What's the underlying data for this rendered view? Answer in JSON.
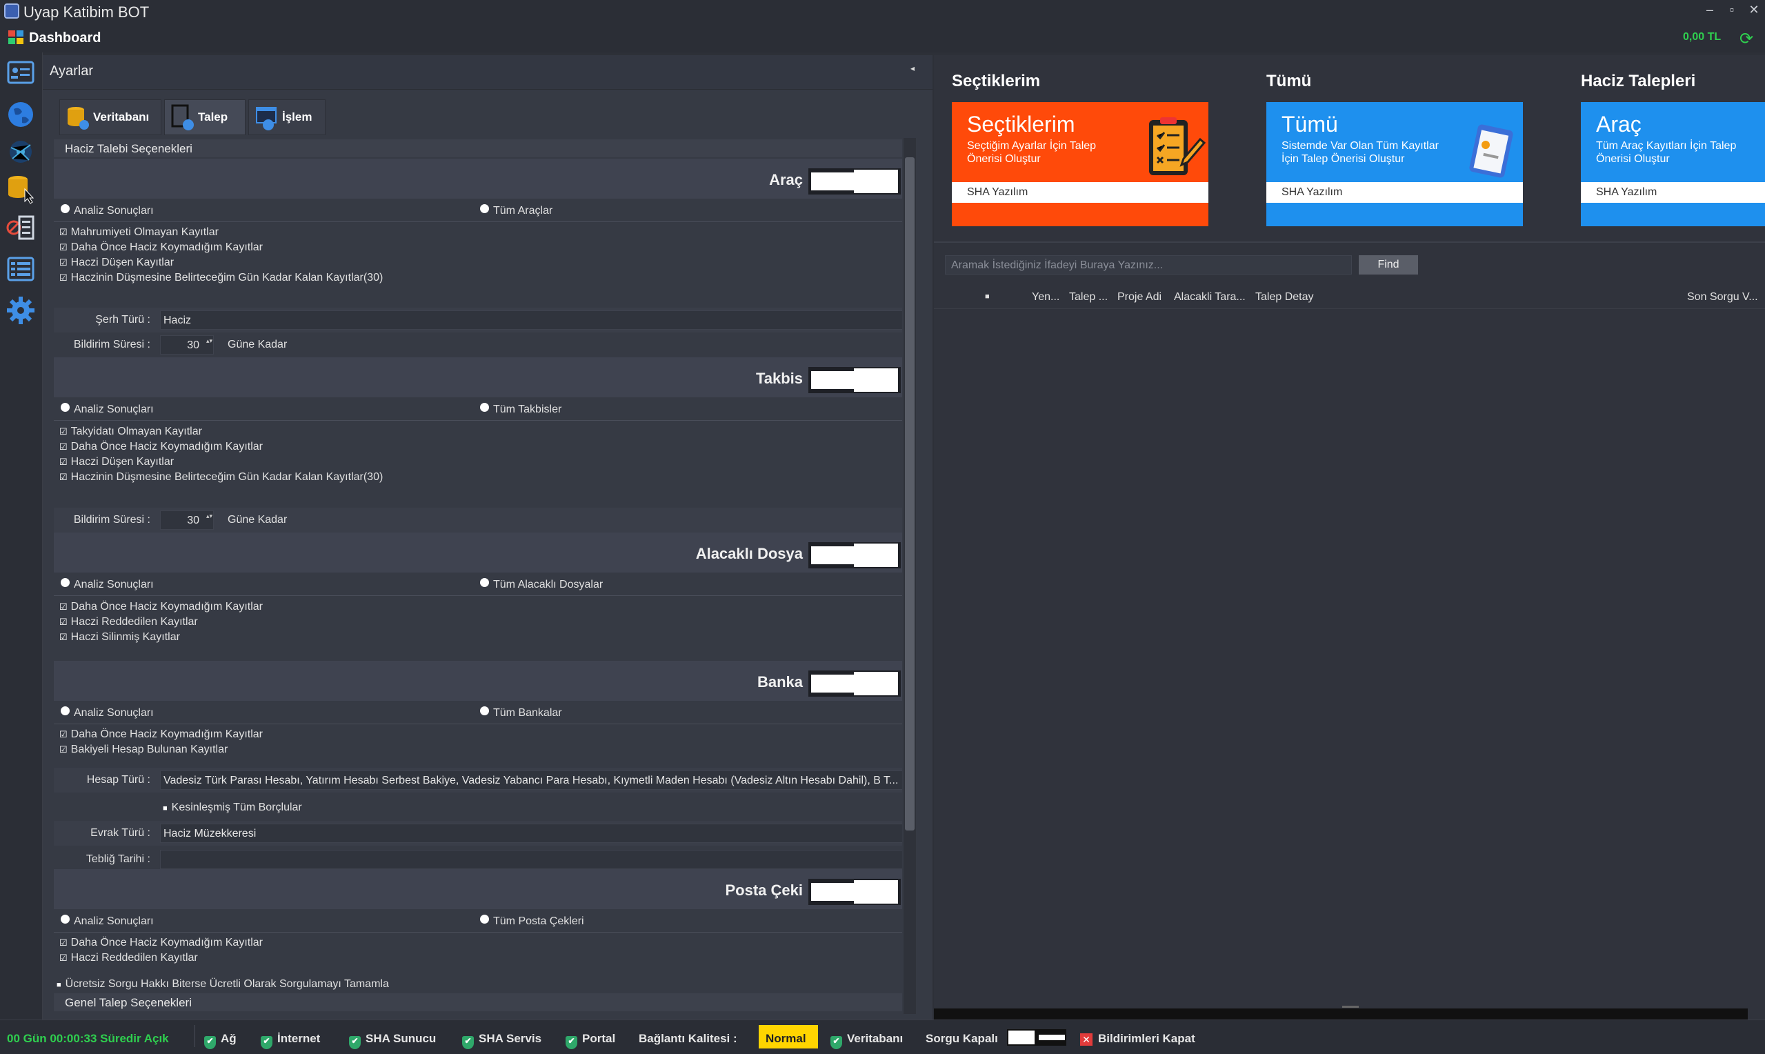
{
  "window": {
    "title": "Uyap Katibim BOT",
    "controls": [
      "–",
      "▫",
      "✕"
    ]
  },
  "header": {
    "title": "Dashboard",
    "balance": "0,00 TL"
  },
  "nav": {
    "icons": [
      "user-list-icon",
      "globe-icon",
      "network-icon",
      "database-icon",
      "checklist-icon",
      "list-icon",
      "gear-icon"
    ]
  },
  "settings": {
    "title": "Ayarlar",
    "tabs": [
      {
        "label": "Veritabanı"
      },
      {
        "label": "Talep"
      },
      {
        "label": "İşlem"
      }
    ],
    "section_title": "Haciz Talebi Seçenekleri",
    "footer_section_title": "Genel Talep Seçenekleri",
    "arac": {
      "title": "Araç",
      "radio_a": "Analiz Sonuçları",
      "radio_b": "Tüm Araçlar",
      "checks": [
        "Mahrumiyeti Olmayan Kayıtlar",
        "Daha Önce Haciz Koymadığım Kayıtlar",
        "Haczi Düşen Kayıtlar",
        "Haczinin Düşmesine Belirteceğim Gün Kadar Kalan Kayıtlar(30)"
      ],
      "serh_label": "Şerh Türü :",
      "serh_value": "Haciz",
      "bildirim_label": "Bildirim Süresi :",
      "bildirim_value": "30",
      "bildirim_unit": "Güne Kadar"
    },
    "takbis": {
      "title": "Takbis",
      "radio_a": "Analiz Sonuçları",
      "radio_b": "Tüm Takbisler",
      "checks": [
        "Takyidatı Olmayan Kayıtlar",
        "Daha Önce Haciz Koymadığım Kayıtlar",
        "Haczi Düşen Kayıtlar",
        "Haczinin Düşmesine Belirteceğim Gün Kadar Kalan Kayıtlar(30)"
      ],
      "bildirim_label": "Bildirim Süresi :",
      "bildirim_value": "30",
      "bildirim_unit": "Güne Kadar"
    },
    "alacakli": {
      "title": "Alacaklı Dosya",
      "radio_a": "Analiz Sonuçları",
      "radio_b": "Tüm Alacaklı Dosyalar",
      "checks": [
        "Daha Önce Haciz Koymadığım Kayıtlar",
        "Haczi Reddedilen Kayıtlar",
        "Haczi Silinmiş Kayıtlar"
      ]
    },
    "banka": {
      "title": "Banka",
      "radio_a": "Analiz Sonuçları",
      "radio_b": "Tüm Bankalar",
      "checks": [
        "Daha Önce Haciz Koymadığım Kayıtlar",
        "Bakiyeli Hesap Bulunan Kayıtlar"
      ],
      "hesap_label": "Hesap Türü :",
      "hesap_value": "Vadesiz Türk Parası Hesabı, Yatırım Hesabı Serbest Bakiye, Vadesiz Yabancı Para Hesabı, Kıymetli Maden Hesabı (Vadesiz Altın Hesabı Dahil), B T...",
      "kesin_label": "Kesinleşmiş Tüm Borçlular",
      "evrak_label": "Evrak Türü :",
      "evrak_value": "Haciz Müzekkeresi",
      "teblig_label": "Tebliğ Tarihi :",
      "teblig_value": ""
    },
    "posta": {
      "title": "Posta Çeki",
      "radio_a": "Analiz Sonuçları",
      "radio_b": "Tüm Posta Çekleri",
      "checks": [
        "Daha Önce Haciz Koymadığım Kayıtlar",
        "Haczi Reddedilen Kayıtlar"
      ]
    },
    "ucretsiz": "Ücretsiz Sorgu Hakkı Biterse Ücretli Olarak Sorgulamayı Tamamla"
  },
  "columns": [
    {
      "title": "Seçtiklerim",
      "tile_title": "Seçtiklerim",
      "tile_sub": "Seçtiğim Ayarlar İçin Talep Önerisi Oluştur",
      "footer": "SHA Yazılım",
      "color": "#ff4a0a",
      "icon": "clipboard-checklist-icon"
    },
    {
      "title": "Tümü",
      "tile_title": "Tümü",
      "tile_sub": "Sistemde Var Olan Tüm Kayıtlar İçin Talep Önerisi Oluştur",
      "footer": "SHA Yazılım",
      "color": "#1e90ee",
      "icon": "clipboard-icon"
    },
    {
      "title": "Haciz Talepleri",
      "tile_title": "Araç",
      "tile_sub": "Tüm Araç Kayıtları İçin Talep Önerisi Oluştur",
      "footer": "SHA Yazılım",
      "color": "#1e90ee",
      "icon": ""
    }
  ],
  "search": {
    "placeholder": "Aramak İstediğiniz İfadeyi Buraya Yazınız...",
    "button": "Find"
  },
  "grid": {
    "columns": [
      "Yen...",
      "Talep ...",
      "Proje Adi",
      "Alacakli Tara...",
      "Talep Detay",
      "Son Sorgu V..."
    ]
  },
  "status": {
    "uptime": "00 Gün 00:00:33 Süredir Açık",
    "ag": "Ağ",
    "internet": "İnternet",
    "sha_sunucu": "SHA Sunucu",
    "sha_servis": "SHA Servis",
    "portal": "Portal",
    "kalite_label": "Bağlantı Kalitesi :",
    "kalite_value": "Normal",
    "veritabani": "Veritabanı",
    "sorgu": "Sorgu Kapalı",
    "bildirim": "Bildirimleri Kapat"
  }
}
